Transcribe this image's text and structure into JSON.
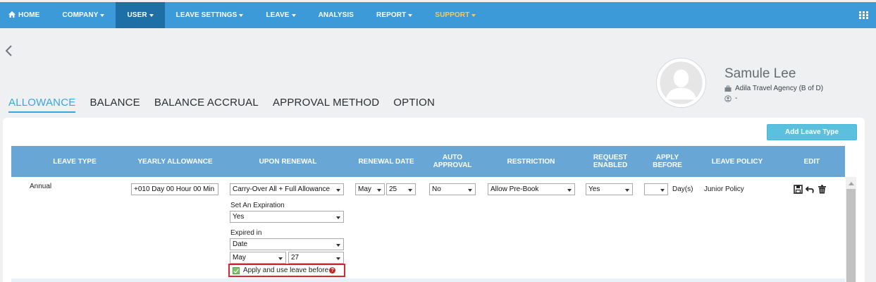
{
  "nav": {
    "items": [
      {
        "label": "HOME",
        "caret": false
      },
      {
        "label": "COMPANY",
        "caret": true
      },
      {
        "label": "USER",
        "caret": true
      },
      {
        "label": "LEAVE SETTINGS",
        "caret": true
      },
      {
        "label": "LEAVE",
        "caret": true
      },
      {
        "label": "ANALYSIS",
        "caret": false
      },
      {
        "label": "REPORT",
        "caret": true
      },
      {
        "label": "SUPPORT",
        "caret": true
      }
    ],
    "active": "USER",
    "colors": {
      "bar": "#3c9ad8",
      "active": "#1f6fa7",
      "support": "#f7c95b"
    }
  },
  "profile": {
    "name": "Samule Lee",
    "company": "Adila Travel Agency (B of D)",
    "extra": "-"
  },
  "tabs": [
    {
      "label": "ALLOWANCE",
      "active": true
    },
    {
      "label": "BALANCE",
      "active": false
    },
    {
      "label": "BALANCE ACCRUAL",
      "active": false
    },
    {
      "label": "APPROVAL METHOD",
      "active": false
    },
    {
      "label": "OPTION",
      "active": false
    }
  ],
  "add_button": "Add Leave Type",
  "table": {
    "headers": {
      "leave_type": "LEAVE TYPE",
      "yearly_allowance": "YEARLY ALLOWANCE",
      "upon_renewal": "UPON RENEWAL",
      "renewal_date": "RENEWAL DATE",
      "auto_approval_1": "AUTO",
      "auto_approval_2": "APPROVAL",
      "restriction": "RESTRICTION",
      "request_enabled_1": "REQUEST",
      "request_enabled_2": "ENABLED",
      "apply_before_1": "APPLY",
      "apply_before_2": "BEFORE",
      "leave_policy": "LEAVE POLICY",
      "edit": "EDIT"
    },
    "row": {
      "leave_type": "Annual",
      "yearly_allowance": "+010 Day 00 Hour 00 Min",
      "upon_renewal": "Carry-Over All + Full Allowance",
      "set_expiration_label": "Set An Expiration",
      "set_expiration": "Yes",
      "expired_in_label": "Expired in",
      "expired_in": "Date",
      "expiry_month": "May",
      "expiry_day": "27",
      "apply_use_label": "Apply and use leave before",
      "apply_use_checked": true,
      "renewal_month": "May",
      "renewal_day": "25",
      "auto_approval": "No",
      "restriction": "Allow Pre-Book",
      "request_enabled": "Yes",
      "apply_before": "",
      "apply_before_unit": "Day(s)",
      "leave_policy": "Junior Policy"
    }
  },
  "icons": [
    "home-icon",
    "grid-menu-icon",
    "back-chevron-icon",
    "briefcase-icon",
    "user-circle-icon",
    "save-icon",
    "undo-icon",
    "trash-icon",
    "help-icon"
  ]
}
